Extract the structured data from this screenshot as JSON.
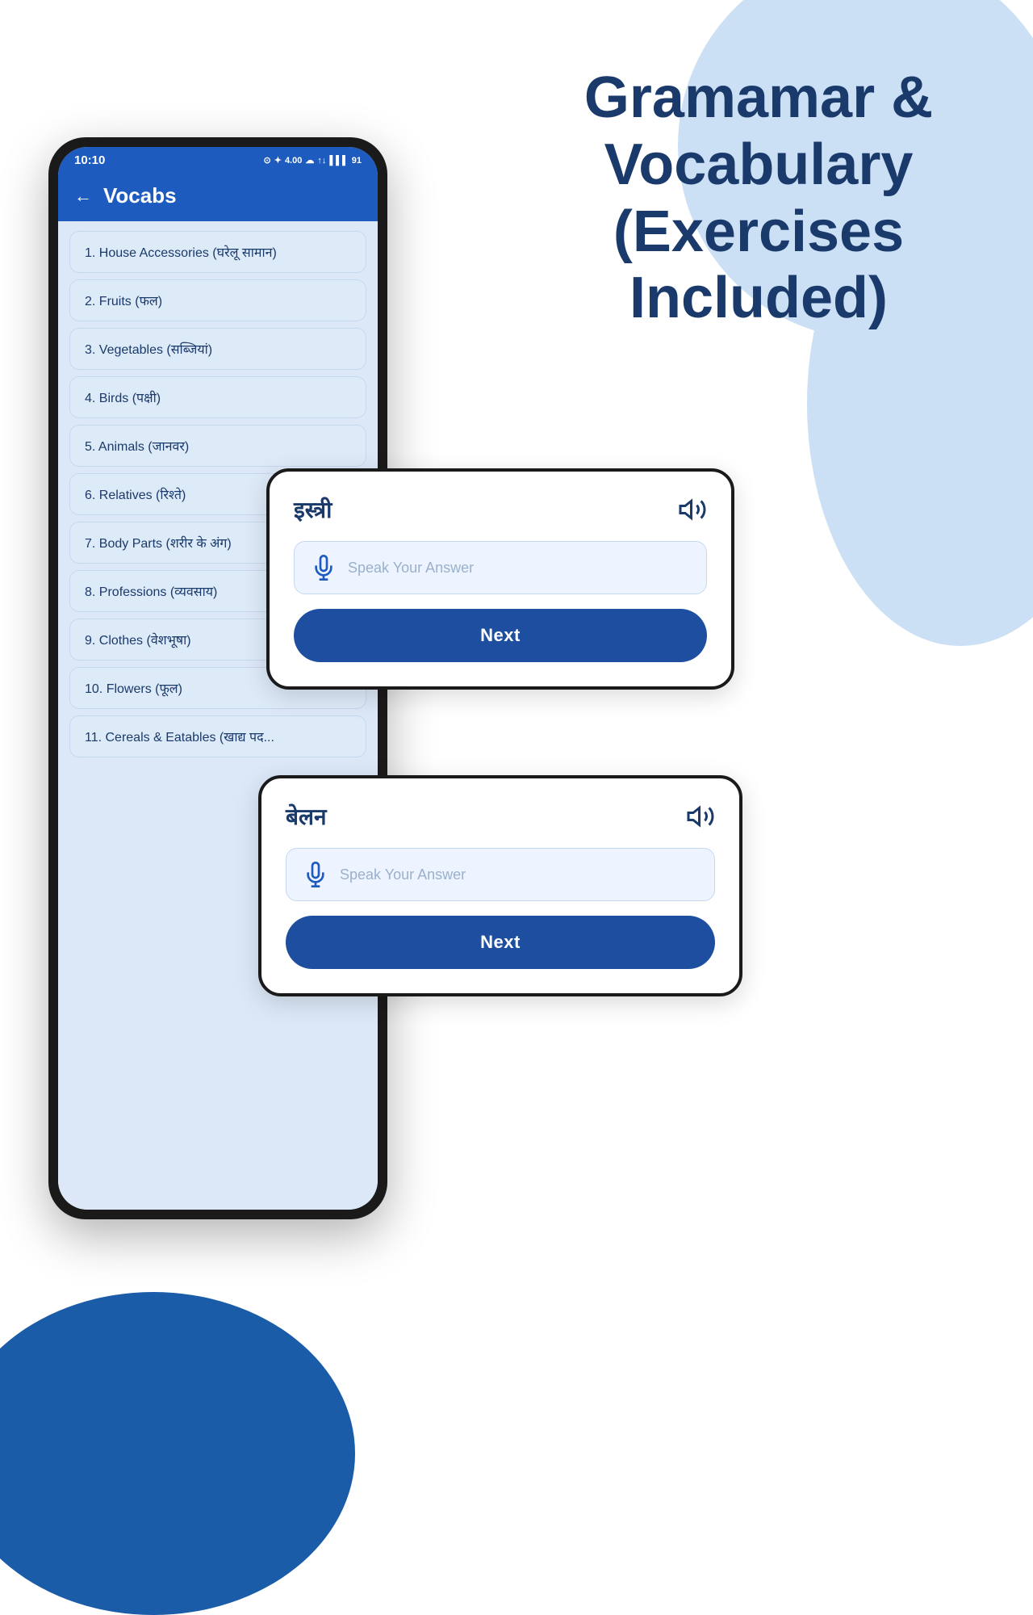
{
  "background": {
    "color": "#ffffff"
  },
  "header": {
    "title_line1": "Gramamar  &",
    "title_line2": "Vocabulary",
    "title_line3": "(Exercises",
    "title_line4": "Included)"
  },
  "phone": {
    "status_bar": {
      "time": "10:10",
      "icons": "⊙ ✦ 4.00 KB/S ☁ ↑↓ ▌▌▌ 91"
    },
    "app_header": {
      "back_label": "←",
      "title": "Vocabs"
    },
    "vocab_items": [
      "1. House Accessories (घरेलू सामान)",
      "2. Fruits (फल)",
      "3. Vegetables (सब्जियां)",
      "4. Birds (पक्षी)",
      "5. Animals (जानवर)",
      "6. Relatives (रिश्ते)",
      "7. Body Parts (शरीर के अंग)",
      "8. Professions (व्यवसाय)",
      "9. Clothes (वेशभूषा)",
      "10. Flowers (फूल)",
      "11. Cereals & Eatables (खाद्य पद..."
    ]
  },
  "exercise_card_1": {
    "word": "इस्त्री",
    "speak_placeholder": "Speak Your Answer",
    "next_label": "Next",
    "speaker_icon": "speaker",
    "mic_icon": "mic"
  },
  "exercise_card_2": {
    "word": "बेलन",
    "speak_placeholder": "Speak Your Answer",
    "next_label": "Next",
    "speaker_icon": "speaker",
    "mic_icon": "mic"
  }
}
